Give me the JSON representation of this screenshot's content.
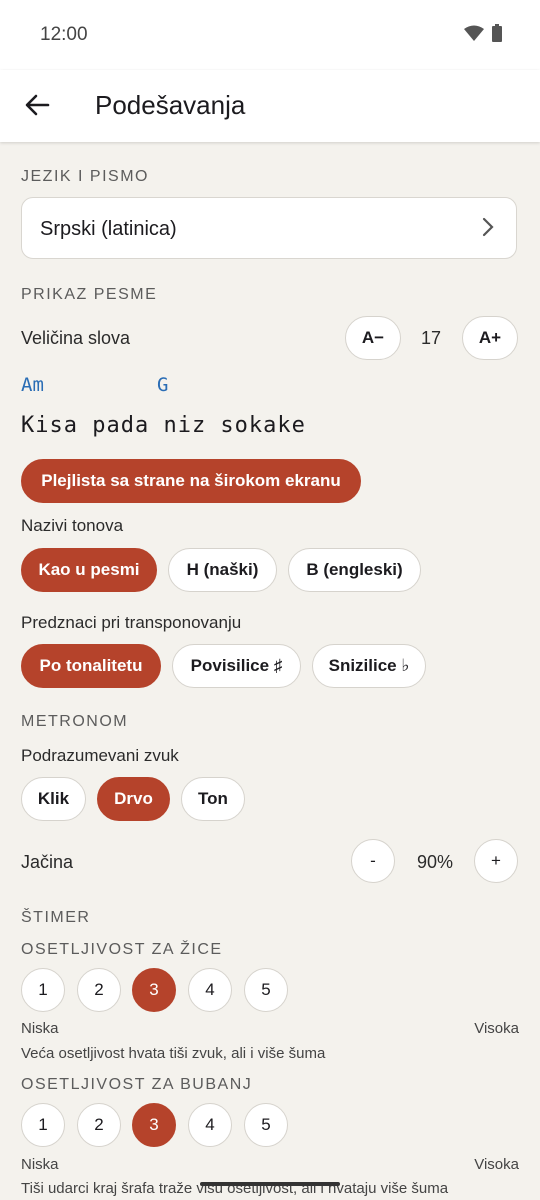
{
  "status": {
    "time": "12:00",
    "icons": [
      "wifi-icon",
      "battery-icon"
    ]
  },
  "appbar": {
    "title": "Podešavanja",
    "back_icon": "arrow-back-icon"
  },
  "language": {
    "header": "JEZIK I PISMO",
    "selected": "Srpski (latinica)"
  },
  "song_display": {
    "header": "PRIKAZ PESME",
    "font_size_label": "Veličina slova",
    "decrease_label": "A−",
    "increase_label": "A+",
    "font_size_value": "17",
    "preview_chord_1": "Am",
    "preview_chord_2": "G",
    "preview_lyric": "Kisa pada niz sokake",
    "sidebar_toggle_label": "Plejlista sa strane na širokom ekranu",
    "tone_names_label": "Nazivi tonova",
    "tone_options": [
      "Kao u pesmi",
      "H (naški)",
      "B (engleski)"
    ],
    "tone_selected": 0,
    "accidentals_label": "Predznaci pri transponovanju",
    "accidental_options": [
      "Po tonalitetu",
      "Povisilice ♯",
      "Snizilice ♭"
    ],
    "accidental_selected": 0
  },
  "metronome": {
    "header": "METRONOM",
    "sound_label": "Podrazumevani zvuk",
    "sound_options": [
      "Klik",
      "Drvo",
      "Ton"
    ],
    "sound_selected": 1,
    "volume_label": "Jačina",
    "minus_label": "-",
    "plus_label": "+",
    "volume_value": "90%"
  },
  "tuner": {
    "header": "ŠTIMER",
    "strings_header": "OSETLJIVOST ZA ŽICE",
    "strings_levels": [
      "1",
      "2",
      "3",
      "4",
      "5"
    ],
    "strings_selected": 2,
    "low_label": "Niska",
    "high_label": "Visoka",
    "strings_hint": "Veća osetljivost hvata tiši zvuk, ali i više šuma",
    "drum_header": "OSETLJIVOST ZA BUBANJ",
    "drum_levels": [
      "1",
      "2",
      "3",
      "4",
      "5"
    ],
    "drum_selected": 2,
    "drum_hint": "Tiši udarci kraj šrafa traže višu osetljivost, ali i hvataju više šuma"
  },
  "colors": {
    "accent": "#b5432b",
    "chord": "#2a6db5",
    "background": "#f4f2ed"
  }
}
